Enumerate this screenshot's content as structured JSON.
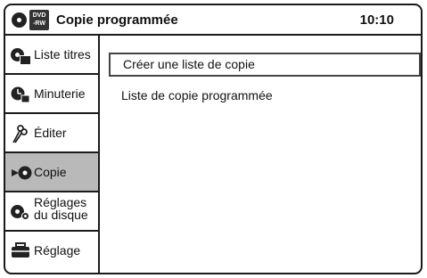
{
  "header": {
    "disc_badge": "DVD\n-RW",
    "title": "Copie programmée",
    "clock": "10:10"
  },
  "sidebar": {
    "items": [
      {
        "label": "Liste titres",
        "icon": "title-list-icon"
      },
      {
        "label": "Minuterie",
        "icon": "timer-icon"
      },
      {
        "label": "Éditer",
        "icon": "scissors-icon"
      },
      {
        "label": "Copie",
        "icon": "copy-icon",
        "selected": true
      },
      {
        "label_line1": "Réglages",
        "label_line2": "du disque",
        "icon": "disc-settings-icon"
      },
      {
        "label": "Réglage",
        "icon": "toolbox-icon"
      }
    ]
  },
  "menu": {
    "items": [
      {
        "label": "Créer une liste de copie",
        "selected": true
      },
      {
        "label": "Liste de copie programmée"
      }
    ]
  }
}
